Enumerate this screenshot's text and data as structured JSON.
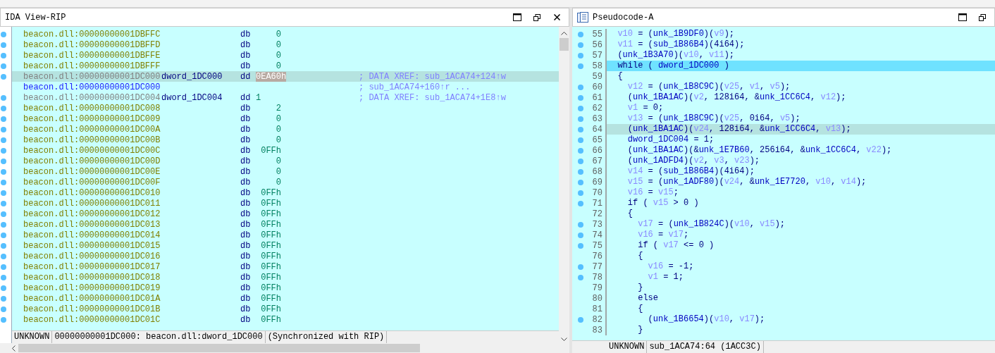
{
  "ida_view": {
    "title": "IDA View-RIP",
    "rows": [
      {
        "kind": "byte",
        "dot": true,
        "selected": false,
        "address": "beacon.dll:00000000001DBFFC",
        "mnemonic": "db",
        "operand": "0"
      },
      {
        "kind": "byte",
        "dot": true,
        "selected": false,
        "address": "beacon.dll:00000000001DBFFD",
        "mnemonic": "db",
        "operand": "0"
      },
      {
        "kind": "byte",
        "dot": true,
        "selected": false,
        "address": "beacon.dll:00000000001DBFFE",
        "mnemonic": "db",
        "operand": "0"
      },
      {
        "kind": "byte",
        "dot": true,
        "selected": false,
        "address": "beacon.dll:00000000001DBFFF",
        "mnemonic": "db",
        "operand": "0"
      },
      {
        "kind": "dword",
        "dot": true,
        "selected": true,
        "address": "beacon.dll:00000000001DC000",
        "label": "dword_1DC000",
        "mnemonic": "dd",
        "operand": "0EA60h",
        "operand_selected": true,
        "comment": "; DATA XREF: sub_1ACA74+124↑w"
      },
      {
        "kind": "continuation",
        "dot": false,
        "selected": false,
        "address": "beacon.dll:00000000001DC000",
        "comment": "; sub_1ACA74+160↑r ..."
      },
      {
        "kind": "dword",
        "dot": true,
        "selected": false,
        "address": "beacon.dll:00000000001DC004",
        "label": "dword_1DC004",
        "mnemonic": "dd",
        "operand": "1",
        "operand_selected": false,
        "comment": "; DATA XREF: sub_1ACA74+1E8↑w"
      },
      {
        "kind": "byte",
        "dot": true,
        "selected": false,
        "address": "beacon.dll:00000000001DC008",
        "mnemonic": "db",
        "operand": "2"
      },
      {
        "kind": "byte",
        "dot": true,
        "selected": false,
        "address": "beacon.dll:00000000001DC009",
        "mnemonic": "db",
        "operand": "0"
      },
      {
        "kind": "byte",
        "dot": true,
        "selected": false,
        "address": "beacon.dll:00000000001DC00A",
        "mnemonic": "db",
        "operand": "0"
      },
      {
        "kind": "byte",
        "dot": true,
        "selected": false,
        "address": "beacon.dll:00000000001DC00B",
        "mnemonic": "db",
        "operand": "0"
      },
      {
        "kind": "byte",
        "dot": true,
        "selected": false,
        "address": "beacon.dll:00000000001DC00C",
        "mnemonic": "db",
        "operand": "0FFh"
      },
      {
        "kind": "byte",
        "dot": true,
        "selected": false,
        "address": "beacon.dll:00000000001DC00D",
        "mnemonic": "db",
        "operand": "0"
      },
      {
        "kind": "byte",
        "dot": true,
        "selected": false,
        "address": "beacon.dll:00000000001DC00E",
        "mnemonic": "db",
        "operand": "0"
      },
      {
        "kind": "byte",
        "dot": true,
        "selected": false,
        "address": "beacon.dll:00000000001DC00F",
        "mnemonic": "db",
        "operand": "0"
      },
      {
        "kind": "byte",
        "dot": true,
        "selected": false,
        "address": "beacon.dll:00000000001DC010",
        "mnemonic": "db",
        "operand": "0FFh"
      },
      {
        "kind": "byte",
        "dot": true,
        "selected": false,
        "address": "beacon.dll:00000000001DC011",
        "mnemonic": "db",
        "operand": "0FFh"
      },
      {
        "kind": "byte",
        "dot": true,
        "selected": false,
        "address": "beacon.dll:00000000001DC012",
        "mnemonic": "db",
        "operand": "0FFh"
      },
      {
        "kind": "byte",
        "dot": true,
        "selected": false,
        "address": "beacon.dll:00000000001DC013",
        "mnemonic": "db",
        "operand": "0FFh"
      },
      {
        "kind": "byte",
        "dot": true,
        "selected": false,
        "address": "beacon.dll:00000000001DC014",
        "mnemonic": "db",
        "operand": "0FFh"
      },
      {
        "kind": "byte",
        "dot": true,
        "selected": false,
        "address": "beacon.dll:00000000001DC015",
        "mnemonic": "db",
        "operand": "0FFh"
      },
      {
        "kind": "byte",
        "dot": true,
        "selected": false,
        "address": "beacon.dll:00000000001DC016",
        "mnemonic": "db",
        "operand": "0FFh"
      },
      {
        "kind": "byte",
        "dot": true,
        "selected": false,
        "address": "beacon.dll:00000000001DC017",
        "mnemonic": "db",
        "operand": "0FFh"
      },
      {
        "kind": "byte",
        "dot": true,
        "selected": false,
        "address": "beacon.dll:00000000001DC018",
        "mnemonic": "db",
        "operand": "0FFh"
      },
      {
        "kind": "byte",
        "dot": true,
        "selected": false,
        "address": "beacon.dll:00000000001DC019",
        "mnemonic": "db",
        "operand": "0FFh"
      },
      {
        "kind": "byte",
        "dot": true,
        "selected": false,
        "address": "beacon.dll:00000000001DC01A",
        "mnemonic": "db",
        "operand": "0FFh"
      },
      {
        "kind": "byte",
        "dot": true,
        "selected": false,
        "address": "beacon.dll:00000000001DC01B",
        "mnemonic": "db",
        "operand": "0FFh"
      },
      {
        "kind": "byte",
        "dot": true,
        "selected": false,
        "address": "beacon.dll:00000000001DC01C",
        "mnemonic": "db",
        "operand": "0FFh"
      }
    ],
    "status": [
      "UNKNOWN",
      "00000000001DC000: beacon.dll:dword_1DC000",
      "(Synchronized with RIP)"
    ]
  },
  "pseudocode": {
    "title": "Pseudocode-A",
    "lines": [
      {
        "number": "55",
        "dot": true,
        "current": false,
        "selected": false,
        "tokens": [
          {
            "kind": "var",
            "text": "  v10"
          },
          {
            "kind": "plain",
            "text": " = ("
          },
          {
            "kind": "func",
            "text": "unk_1B9DF0"
          },
          {
            "kind": "plain",
            "text": ")("
          },
          {
            "kind": "var",
            "text": "v9"
          },
          {
            "kind": "plain",
            "text": ");"
          }
        ]
      },
      {
        "number": "56",
        "dot": true,
        "current": false,
        "selected": false,
        "tokens": [
          {
            "kind": "var",
            "text": "  v11"
          },
          {
            "kind": "plain",
            "text": " = ("
          },
          {
            "kind": "func",
            "text": "sub_1B86B4"
          },
          {
            "kind": "plain",
            "text": ")(4i64);"
          }
        ]
      },
      {
        "number": "57",
        "dot": true,
        "current": false,
        "selected": false,
        "tokens": [
          {
            "kind": "plain",
            "text": "  ("
          },
          {
            "kind": "func",
            "text": "unk_1B3A70"
          },
          {
            "kind": "plain",
            "text": ")("
          },
          {
            "kind": "var",
            "text": "v10"
          },
          {
            "kind": "plain",
            "text": ", "
          },
          {
            "kind": "var",
            "text": "v11"
          },
          {
            "kind": "plain",
            "text": ");"
          }
        ]
      },
      {
        "number": "58",
        "dot": true,
        "current": true,
        "selected": false,
        "tokens": [
          {
            "kind": "plain",
            "text": "  while ( "
          },
          {
            "kind": "func",
            "text": "dword_1DC000"
          },
          {
            "kind": "plain",
            "text": " )"
          }
        ]
      },
      {
        "number": "59",
        "dot": false,
        "current": false,
        "selected": false,
        "tokens": [
          {
            "kind": "plain",
            "text": "  {"
          }
        ]
      },
      {
        "number": "60",
        "dot": true,
        "current": false,
        "selected": false,
        "tokens": [
          {
            "kind": "var",
            "text": "    v12"
          },
          {
            "kind": "plain",
            "text": " = ("
          },
          {
            "kind": "func",
            "text": "unk_1B8C9C"
          },
          {
            "kind": "plain",
            "text": ")("
          },
          {
            "kind": "var",
            "text": "v25"
          },
          {
            "kind": "plain",
            "text": ", "
          },
          {
            "kind": "var",
            "text": "v1"
          },
          {
            "kind": "plain",
            "text": ", "
          },
          {
            "kind": "var",
            "text": "v5"
          },
          {
            "kind": "plain",
            "text": ");"
          }
        ]
      },
      {
        "number": "61",
        "dot": true,
        "current": false,
        "selected": false,
        "tokens": [
          {
            "kind": "plain",
            "text": "    ("
          },
          {
            "kind": "func",
            "text": "unk_1BA1AC"
          },
          {
            "kind": "plain",
            "text": ")("
          },
          {
            "kind": "var",
            "text": "v2"
          },
          {
            "kind": "plain",
            "text": ", 128i64, &"
          },
          {
            "kind": "func",
            "text": "unk_1CC6C4"
          },
          {
            "kind": "plain",
            "text": ", "
          },
          {
            "kind": "var",
            "text": "v12"
          },
          {
            "kind": "plain",
            "text": ");"
          }
        ]
      },
      {
        "number": "62",
        "dot": true,
        "current": false,
        "selected": false,
        "tokens": [
          {
            "kind": "var",
            "text": "    v1"
          },
          {
            "kind": "plain",
            "text": " = 0;"
          }
        ]
      },
      {
        "number": "63",
        "dot": true,
        "current": false,
        "selected": false,
        "tokens": [
          {
            "kind": "var",
            "text": "    v13"
          },
          {
            "kind": "plain",
            "text": " = ("
          },
          {
            "kind": "func",
            "text": "unk_1B8C9C"
          },
          {
            "kind": "plain",
            "text": ")("
          },
          {
            "kind": "var",
            "text": "v25"
          },
          {
            "kind": "plain",
            "text": ", 0i64, "
          },
          {
            "kind": "var",
            "text": "v5"
          },
          {
            "kind": "plain",
            "text": ");"
          }
        ]
      },
      {
        "number": "64",
        "dot": true,
        "current": false,
        "selected": true,
        "tokens": [
          {
            "kind": "plain",
            "text": "    ("
          },
          {
            "kind": "func",
            "text": "unk_1BA1AC"
          },
          {
            "kind": "plain",
            "text": ")("
          },
          {
            "kind": "var",
            "text": "v24"
          },
          {
            "kind": "plain",
            "text": ", 128i64, &"
          },
          {
            "kind": "func",
            "text": "unk_1CC6C4"
          },
          {
            "kind": "plain",
            "text": ", "
          },
          {
            "kind": "var",
            "text": "v13"
          },
          {
            "kind": "plain",
            "text": ");"
          }
        ]
      },
      {
        "number": "65",
        "dot": true,
        "current": false,
        "selected": false,
        "tokens": [
          {
            "kind": "func",
            "text": "    dword_1DC004"
          },
          {
            "kind": "plain",
            "text": " = 1;"
          }
        ]
      },
      {
        "number": "66",
        "dot": true,
        "current": false,
        "selected": false,
        "tokens": [
          {
            "kind": "plain",
            "text": "    ("
          },
          {
            "kind": "func",
            "text": "unk_1BA1AC"
          },
          {
            "kind": "plain",
            "text": ")(&"
          },
          {
            "kind": "func",
            "text": "unk_1E7B60"
          },
          {
            "kind": "plain",
            "text": ", 256i64, &"
          },
          {
            "kind": "func",
            "text": "unk_1CC6C4"
          },
          {
            "kind": "plain",
            "text": ", "
          },
          {
            "kind": "var",
            "text": "v22"
          },
          {
            "kind": "plain",
            "text": ");"
          }
        ]
      },
      {
        "number": "67",
        "dot": true,
        "current": false,
        "selected": false,
        "tokens": [
          {
            "kind": "plain",
            "text": "    ("
          },
          {
            "kind": "func",
            "text": "unk_1ADFD4"
          },
          {
            "kind": "plain",
            "text": ")("
          },
          {
            "kind": "var",
            "text": "v2"
          },
          {
            "kind": "plain",
            "text": ", "
          },
          {
            "kind": "var",
            "text": "v3"
          },
          {
            "kind": "plain",
            "text": ", "
          },
          {
            "kind": "var",
            "text": "v23"
          },
          {
            "kind": "plain",
            "text": ");"
          }
        ]
      },
      {
        "number": "68",
        "dot": true,
        "current": false,
        "selected": false,
        "tokens": [
          {
            "kind": "var",
            "text": "    v14"
          },
          {
            "kind": "plain",
            "text": " = ("
          },
          {
            "kind": "func",
            "text": "sub_1B86B4"
          },
          {
            "kind": "plain",
            "text": ")(4i64);"
          }
        ]
      },
      {
        "number": "69",
        "dot": true,
        "current": false,
        "selected": false,
        "tokens": [
          {
            "kind": "var",
            "text": "    v15"
          },
          {
            "kind": "plain",
            "text": " = ("
          },
          {
            "kind": "func",
            "text": "unk_1ADF80"
          },
          {
            "kind": "plain",
            "text": ")("
          },
          {
            "kind": "var",
            "text": "v24"
          },
          {
            "kind": "plain",
            "text": ", &"
          },
          {
            "kind": "func",
            "text": "unk_1E7720"
          },
          {
            "kind": "plain",
            "text": ", "
          },
          {
            "kind": "var",
            "text": "v10"
          },
          {
            "kind": "plain",
            "text": ", "
          },
          {
            "kind": "var",
            "text": "v14"
          },
          {
            "kind": "plain",
            "text": ");"
          }
        ]
      },
      {
        "number": "70",
        "dot": true,
        "current": false,
        "selected": false,
        "tokens": [
          {
            "kind": "var",
            "text": "    v16"
          },
          {
            "kind": "plain",
            "text": " = "
          },
          {
            "kind": "var",
            "text": "v15"
          },
          {
            "kind": "plain",
            "text": ";"
          }
        ]
      },
      {
        "number": "71",
        "dot": true,
        "current": false,
        "selected": false,
        "tokens": [
          {
            "kind": "plain",
            "text": "    if ( "
          },
          {
            "kind": "var",
            "text": "v15"
          },
          {
            "kind": "plain",
            "text": " > 0 )"
          }
        ]
      },
      {
        "number": "72",
        "dot": false,
        "current": false,
        "selected": false,
        "tokens": [
          {
            "kind": "plain",
            "text": "    {"
          }
        ]
      },
      {
        "number": "73",
        "dot": true,
        "current": false,
        "selected": false,
        "tokens": [
          {
            "kind": "var",
            "text": "      v17"
          },
          {
            "kind": "plain",
            "text": " = ("
          },
          {
            "kind": "func",
            "text": "unk_1B824C"
          },
          {
            "kind": "plain",
            "text": ")("
          },
          {
            "kind": "var",
            "text": "v10"
          },
          {
            "kind": "plain",
            "text": ", "
          },
          {
            "kind": "var",
            "text": "v15"
          },
          {
            "kind": "plain",
            "text": ");"
          }
        ]
      },
      {
        "number": "74",
        "dot": true,
        "current": false,
        "selected": false,
        "tokens": [
          {
            "kind": "var",
            "text": "      v16"
          },
          {
            "kind": "plain",
            "text": " = "
          },
          {
            "kind": "var",
            "text": "v17"
          },
          {
            "kind": "plain",
            "text": ";"
          }
        ]
      },
      {
        "number": "75",
        "dot": true,
        "current": false,
        "selected": false,
        "tokens": [
          {
            "kind": "plain",
            "text": "      if ( "
          },
          {
            "kind": "var",
            "text": "v17"
          },
          {
            "kind": "plain",
            "text": " <= 0 )"
          }
        ]
      },
      {
        "number": "76",
        "dot": false,
        "current": false,
        "selected": false,
        "tokens": [
          {
            "kind": "plain",
            "text": "      {"
          }
        ]
      },
      {
        "number": "77",
        "dot": true,
        "current": false,
        "selected": false,
        "tokens": [
          {
            "kind": "var",
            "text": "        v16"
          },
          {
            "kind": "plain",
            "text": " = -1;"
          }
        ]
      },
      {
        "number": "78",
        "dot": true,
        "current": false,
        "selected": false,
        "tokens": [
          {
            "kind": "var",
            "text": "        v1"
          },
          {
            "kind": "plain",
            "text": " = 1;"
          }
        ]
      },
      {
        "number": "79",
        "dot": false,
        "current": false,
        "selected": false,
        "tokens": [
          {
            "kind": "plain",
            "text": "      }"
          }
        ]
      },
      {
        "number": "80",
        "dot": false,
        "current": false,
        "selected": false,
        "tokens": [
          {
            "kind": "plain",
            "text": "      else"
          }
        ]
      },
      {
        "number": "81",
        "dot": false,
        "current": false,
        "selected": false,
        "tokens": [
          {
            "kind": "plain",
            "text": "      {"
          }
        ]
      },
      {
        "number": "82",
        "dot": true,
        "current": false,
        "selected": false,
        "tokens": [
          {
            "kind": "plain",
            "text": "        ("
          },
          {
            "kind": "func",
            "text": "unk_1B6654"
          },
          {
            "kind": "plain",
            "text": ")("
          },
          {
            "kind": "var",
            "text": "v10"
          },
          {
            "kind": "plain",
            "text": ", "
          },
          {
            "kind": "var",
            "text": "v17"
          },
          {
            "kind": "plain",
            "text": ");"
          }
        ]
      },
      {
        "number": "83",
        "dot": false,
        "current": false,
        "selected": false,
        "tokens": [
          {
            "kind": "plain",
            "text": "      }"
          }
        ]
      }
    ],
    "status": [
      "UNKNOWN",
      "sub_1ACA74:64 (1ACC3C)"
    ]
  }
}
